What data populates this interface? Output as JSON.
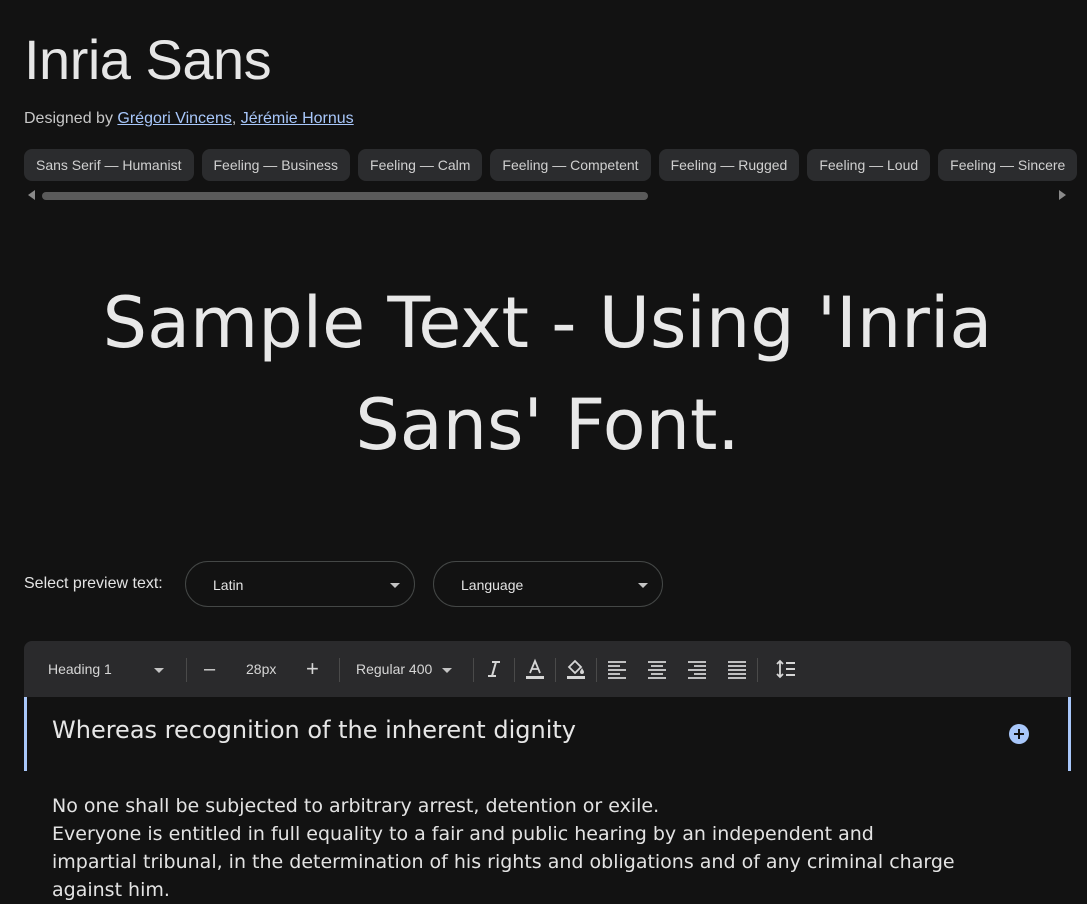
{
  "font": {
    "name": "Inria Sans",
    "designed_by_label": "Designed by",
    "designers": [
      "Grégori Vincens",
      "Jérémie Hornus"
    ],
    "separator": ","
  },
  "tags": [
    "Sans Serif — Humanist",
    "Feeling — Business",
    "Feeling — Calm",
    "Feeling — Competent",
    "Feeling — Rugged",
    "Feeling — Loud",
    "Feeling — Sincere"
  ],
  "tag_scroll": {
    "visible_fraction": 0.6
  },
  "sample_text": "Sample Text - Using 'Inria Sans' Font.",
  "preview": {
    "label": "Select preview text:",
    "script_select": "Latin",
    "language_select": "Language"
  },
  "toolbar": {
    "style": "Heading 1",
    "decrease": "–",
    "size": "28px",
    "increase": "+",
    "weight": "Regular 400",
    "icons": [
      "italic-icon",
      "text-color-icon",
      "highlight-color-icon",
      "align-left-icon",
      "align-center-icon",
      "align-right-icon",
      "align-justify-icon",
      "line-spacing-icon"
    ]
  },
  "editor": {
    "heading": "Whereas recognition of the inherent dignity",
    "body": [
      "No one shall be subjected to arbitrary arrest, detention or exile.",
      "Everyone is entitled in full equality to a fair and public hearing by an independent and impartial tribunal, in the determination of his rights and obligations and of any criminal charge against him."
    ]
  },
  "colors": {
    "background": "#121212",
    "chip": "#2b2c2e",
    "link": "#a8c7fa",
    "accent": "#a8c7fa"
  }
}
